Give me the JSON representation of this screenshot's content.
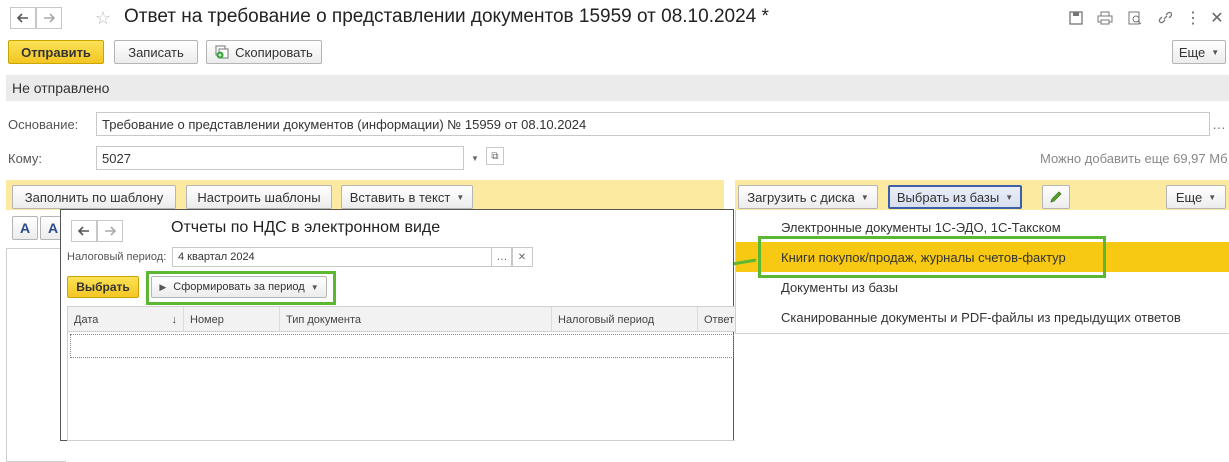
{
  "window": {
    "title": "Ответ на требование о представлении документов 15959 от 08.10.2024 *"
  },
  "toolbar": {
    "send_label": "Отправить",
    "save_label": "Записать",
    "copy_label": "Скопировать",
    "more_label": "Еще"
  },
  "status": {
    "text": "Не отправлено"
  },
  "form": {
    "basis_label": "Основание:",
    "basis_value": "Требование о представлении документов (информации) № 15959 от 08.10.2024",
    "to_label": "Кому:",
    "to_value": "5027",
    "size_hint": "Можно добавить еще 69,97 Мб"
  },
  "left_toolbar": {
    "fill_template": "Заполнить по шаблону",
    "setup_templates": "Настроить шаблоны",
    "insert_text": "Вставить в текст"
  },
  "format_bar": {
    "bold_a": "A",
    "italic_a": "A"
  },
  "right_toolbar": {
    "load_disk": "Загрузить с диска",
    "choose_base": "Выбрать из базы",
    "more_label": "Еще"
  },
  "dropdown": {
    "items": [
      "Электронные документы 1С-ЭДО, 1С-Такском",
      "Книги покупок/продаж, журналы счетов-фактур",
      "Документы из базы",
      "Сканированные документы и PDF-файлы из предыдущих ответов"
    ],
    "active_index": 1
  },
  "popup": {
    "title": "Отчеты по НДС в электронном виде",
    "period_label": "Налоговый период:",
    "period_value": "4 квартал 2024",
    "choose_label": "Выбрать",
    "form_label": "Сформировать за период",
    "columns": [
      "Дата",
      "Номер",
      "Тип документа",
      "Налоговый период",
      "Ответ"
    ]
  },
  "colors": {
    "accent_yellow": "#f7c913",
    "highlight_green": "#5cb832",
    "bar_yellow": "#fbeaa0"
  }
}
